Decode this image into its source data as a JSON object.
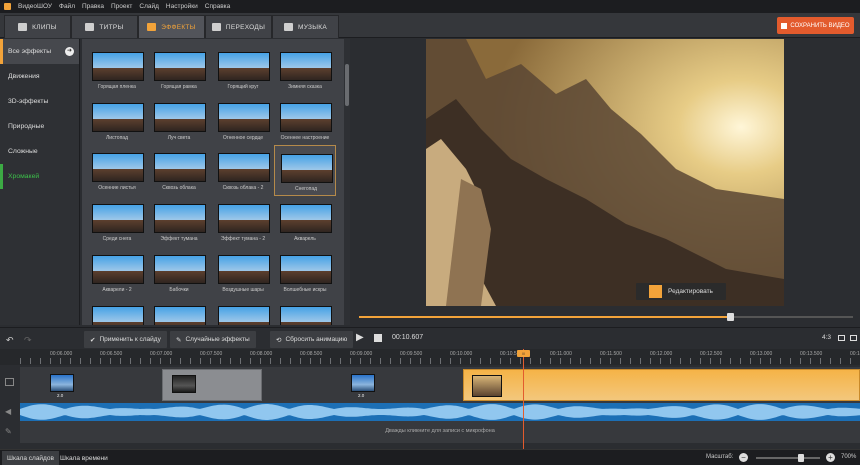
{
  "menu": {
    "app_name": "ВидеоШОУ",
    "items": [
      "Файл",
      "Правка",
      "Проект",
      "Слайд",
      "Настройки",
      "Справка"
    ]
  },
  "tabs": [
    {
      "label": "КЛИПЫ",
      "icon": "clips-icon"
    },
    {
      "label": "ТИТРЫ",
      "icon": "titles-icon"
    },
    {
      "label": "ЭФФЕКТЫ",
      "icon": "effects-icon",
      "active": true
    },
    {
      "label": "ПЕРЕХОДЫ",
      "icon": "transitions-icon"
    },
    {
      "label": "МУЗЫКА",
      "icon": "music-icon"
    }
  ],
  "save_button": "СОХРАНИТЬ ВИДЕО",
  "sidebar": {
    "items": [
      "Все эффекты",
      "Движения",
      "3D-эффекты",
      "Природные",
      "Сложные",
      "Хромакей"
    ]
  },
  "effects": [
    "Горящая пленка",
    "Горящая рамка",
    "Горящий круг",
    "Зимняя сказка",
    "Листопад",
    "Луч света",
    "Огненное сердце",
    "Осеннее настроение",
    "Осенние листья",
    "Сквозь облака",
    "Сквозь облака - 2",
    "Снегопад",
    "Среди снега",
    "Эффект тумана",
    "Эффект тумана - 2",
    "Акварель",
    "Акварели - 2",
    "Бабочки",
    "Воздушные шары",
    "Волшебные искры"
  ],
  "selected_effect": "Снегопад",
  "preview": {
    "edit_button": "Редактировать",
    "progress": 0.75
  },
  "toolbar": {
    "apply": "Применить к слайду",
    "random": "Случайные эффекты",
    "reset": "Сбросить анимацию",
    "time": "00:10.607",
    "aspect": "4:3"
  },
  "ruler": [
    "00:06.000",
    "00:06.500",
    "00:07.000",
    "00:07.500",
    "00:08.000",
    "00:08.500",
    "00:09.000",
    "00:09.500",
    "00:10.000",
    "00:10.5",
    "00:11.000",
    "00:11.500",
    "00:12.000",
    "00:12.500",
    "00:13.000",
    "00:13.500",
    "00:14.000"
  ],
  "timeline": {
    "clip_a_duration": "2.0",
    "clip_b_duration": "2.0",
    "mic_hint": "Дважды кликните для записи с микрофона"
  },
  "bottom": {
    "tab_slides": "Шкала слайдов",
    "tab_timeline": "Шкала времени",
    "zoom_label": "Масштаб:",
    "zoom_value": "700%"
  },
  "colors": {
    "accent": "#f2a33a",
    "save": "#e35b2d",
    "audio": "#1c6fb5"
  }
}
